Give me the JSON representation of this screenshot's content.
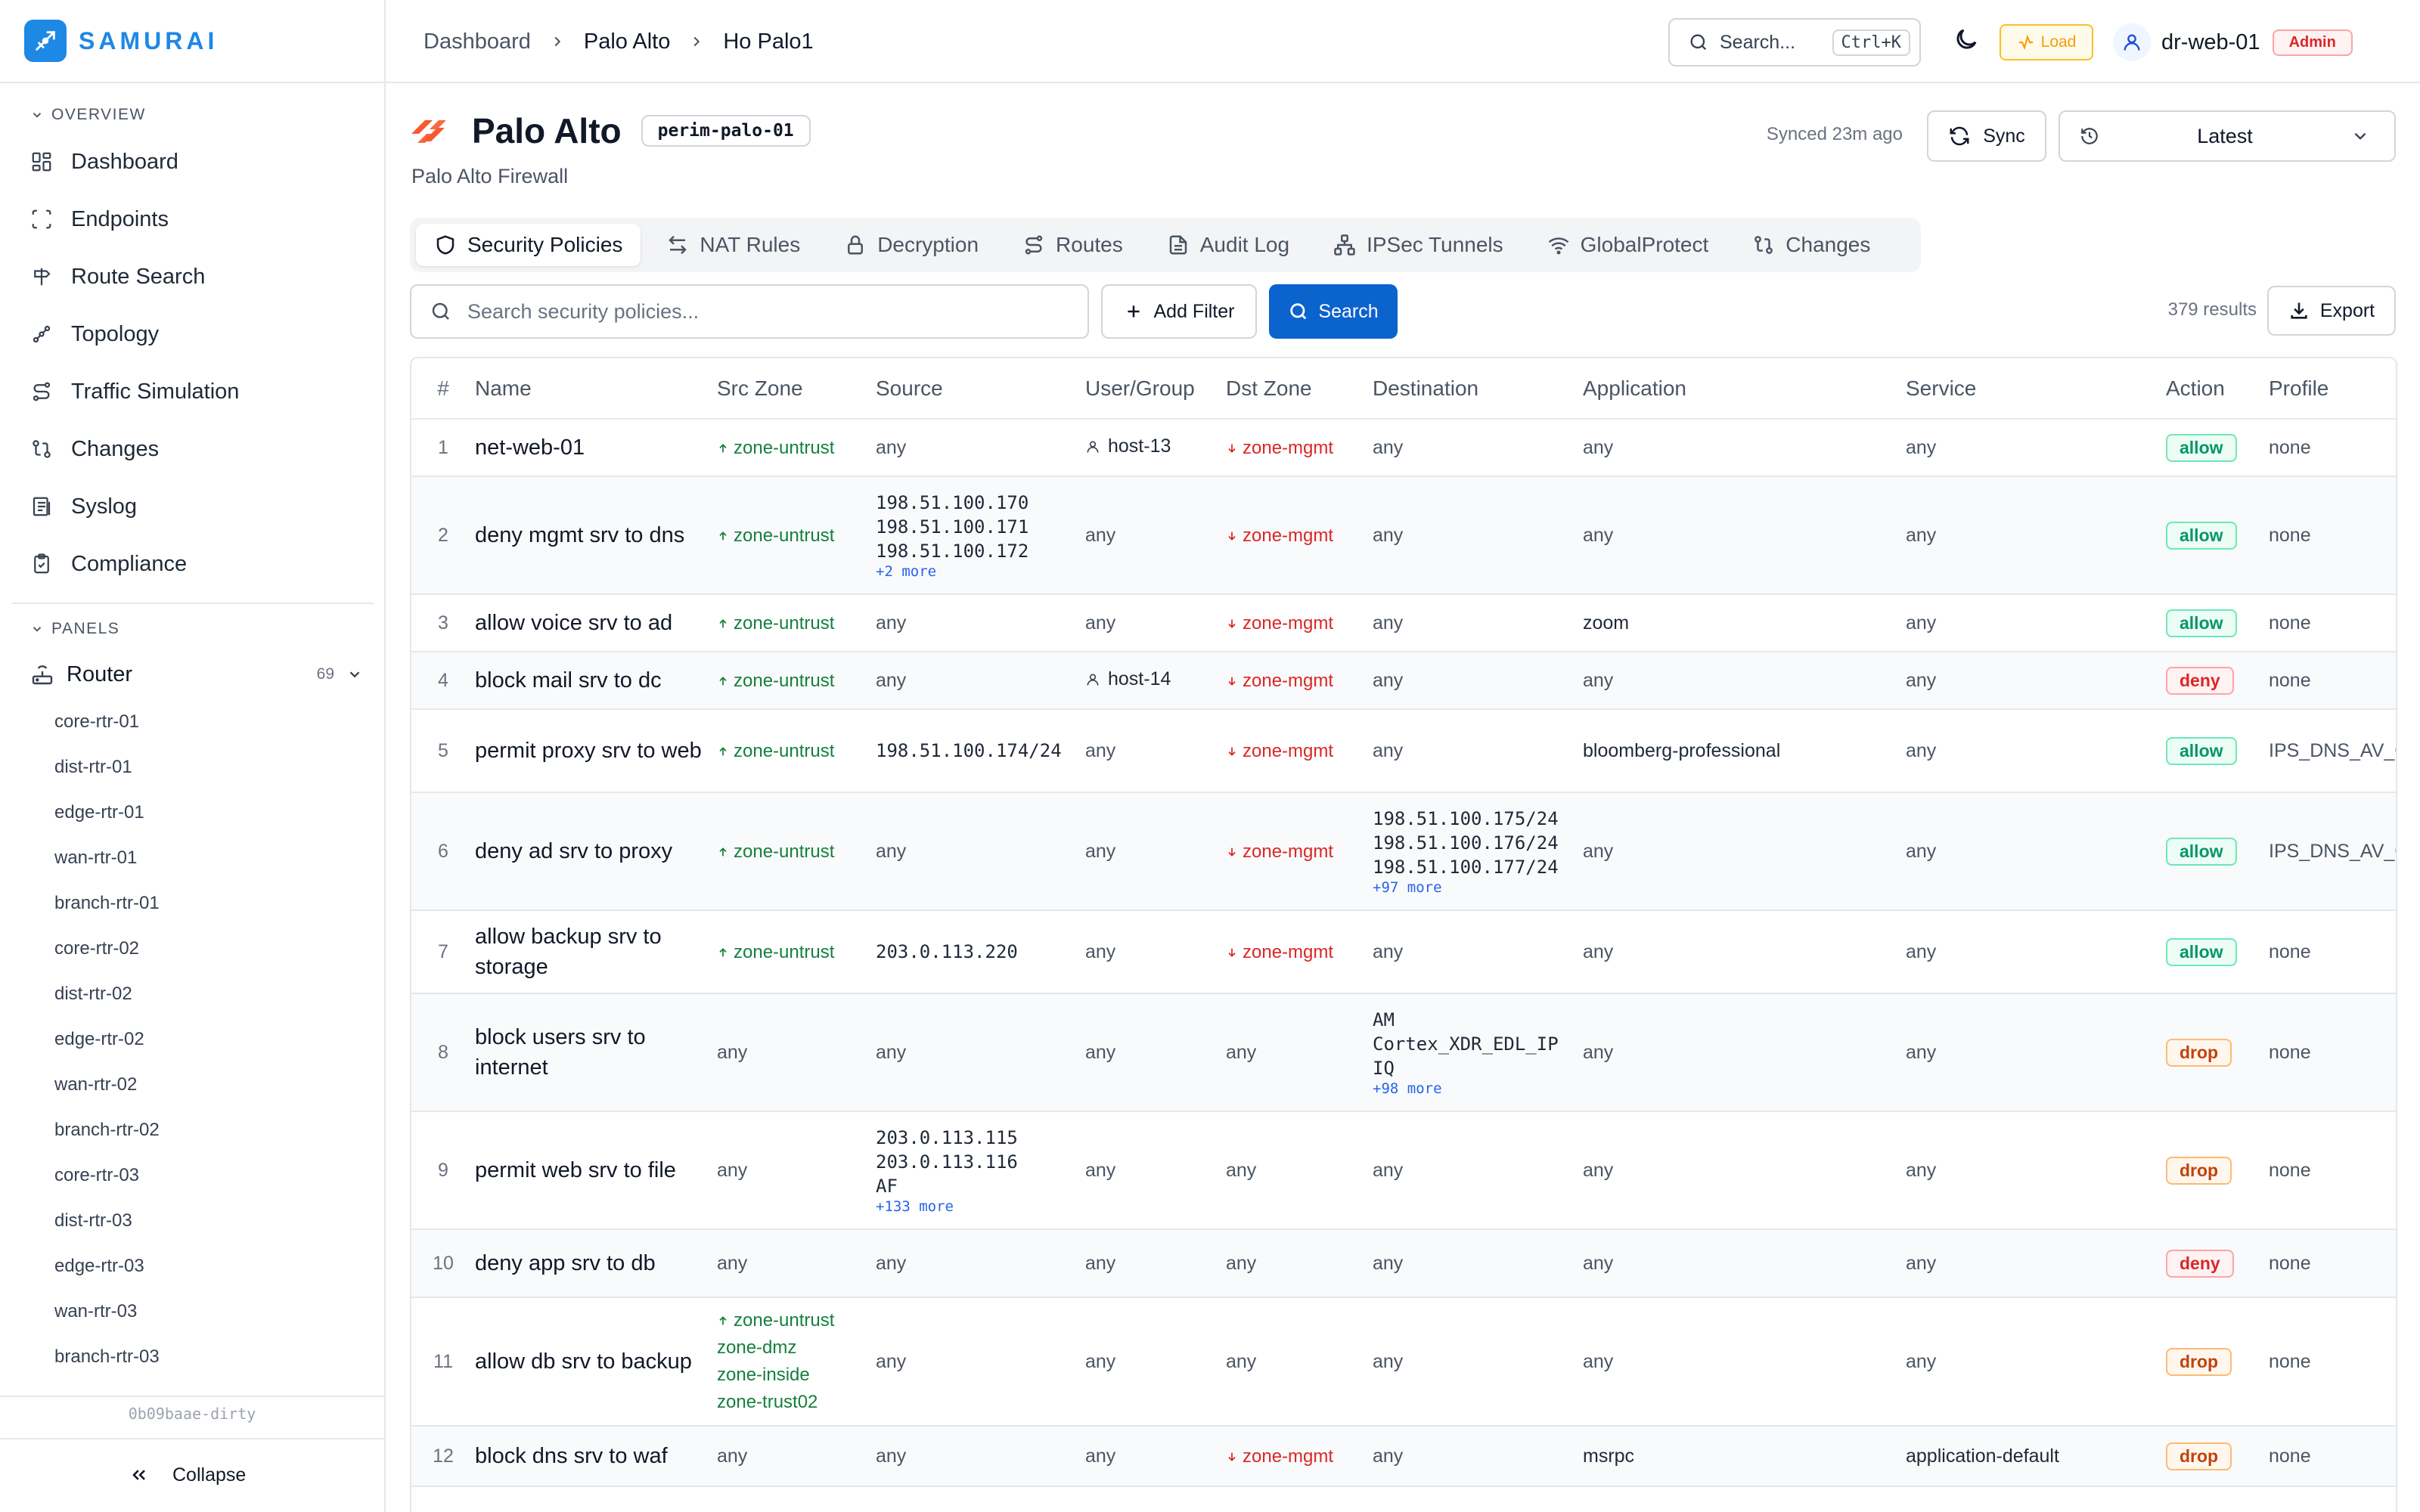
{
  "brand": {
    "name": "SAMURAI"
  },
  "sidebar": {
    "overview_label": "OVERVIEW",
    "nav": [
      {
        "label": "Dashboard",
        "icon": "grid-icon"
      },
      {
        "label": "Endpoints",
        "icon": "scan-icon"
      },
      {
        "label": "Route Search",
        "icon": "signpost-icon"
      },
      {
        "label": "Topology",
        "icon": "topology-icon"
      },
      {
        "label": "Traffic Simulation",
        "icon": "route-icon"
      },
      {
        "label": "Changes",
        "icon": "git-compare-icon"
      },
      {
        "label": "Syslog",
        "icon": "logs-icon"
      },
      {
        "label": "Compliance",
        "icon": "clipboard-check-icon"
      }
    ],
    "panels_label": "PANELS",
    "router": {
      "label": "Router",
      "count": "69"
    },
    "routers": [
      "core-rtr-01",
      "dist-rtr-01",
      "edge-rtr-01",
      "wan-rtr-01",
      "branch-rtr-01",
      "core-rtr-02",
      "dist-rtr-02",
      "edge-rtr-02",
      "wan-rtr-02",
      "branch-rtr-02",
      "core-rtr-03",
      "dist-rtr-03",
      "edge-rtr-03",
      "wan-rtr-03",
      "branch-rtr-03"
    ],
    "version": "0b09baae-dirty",
    "collapse_label": "Collapse"
  },
  "topbar": {
    "breadcrumb": [
      "Dashboard",
      "Palo Alto",
      "Ho Palo1"
    ],
    "search_placeholder": "Search...",
    "search_shortcut": "Ctrl+K",
    "load_label": "Load",
    "user": "dr-web-01",
    "role": "Admin"
  },
  "page": {
    "title": "Palo Alto",
    "hostname": "perim-palo-01",
    "subtitle": "Palo Alto Firewall",
    "synced": "Synced 23m ago",
    "sync_label": "Sync",
    "version_value": "Latest"
  },
  "tabs": [
    {
      "label": "Security Policies",
      "icon": "shield-icon"
    },
    {
      "label": "NAT Rules",
      "icon": "arrows-left-right-icon"
    },
    {
      "label": "Decryption",
      "icon": "lock-icon"
    },
    {
      "label": "Routes",
      "icon": "route-icon"
    },
    {
      "label": "Audit Log",
      "icon": "file-text-icon"
    },
    {
      "label": "IPSec Tunnels",
      "icon": "network-icon"
    },
    {
      "label": "GlobalProtect",
      "icon": "wifi-icon"
    },
    {
      "label": "Changes",
      "icon": "git-compare-icon"
    }
  ],
  "toolbar": {
    "search_placeholder": "Search security policies...",
    "add_filter": "Add Filter",
    "search": "Search",
    "results": "379 results",
    "export": "Export"
  },
  "table": {
    "columns": [
      "#",
      "Name",
      "Src Zone",
      "Source",
      "User/Group",
      "Dst Zone",
      "Destination",
      "Application",
      "Service",
      "Action",
      "Profile"
    ],
    "rows": [
      {
        "num": "1",
        "name": "net-web-01",
        "src_zone": [
          "zone-untrust"
        ],
        "source": [
          "any"
        ],
        "source_more": "",
        "user": "host-13",
        "dst_zone": "zone-mgmt",
        "destination": [
          "any"
        ],
        "dest_more": "",
        "application": "any",
        "service": "any",
        "action": "allow",
        "profile": "none"
      },
      {
        "num": "2",
        "name": "deny mgmt srv to dns",
        "src_zone": [
          "zone-untrust"
        ],
        "source": [
          "198.51.100.170",
          "198.51.100.171",
          "198.51.100.172"
        ],
        "source_more": "+2 more",
        "user": "any",
        "dst_zone": "zone-mgmt",
        "destination": [
          "any"
        ],
        "dest_more": "",
        "application": "any",
        "service": "any",
        "action": "allow",
        "profile": "none"
      },
      {
        "num": "3",
        "name": "allow voice srv to ad",
        "src_zone": [
          "zone-untrust"
        ],
        "source": [
          "any"
        ],
        "source_more": "",
        "user": "any",
        "dst_zone": "zone-mgmt",
        "destination": [
          "any"
        ],
        "dest_more": "",
        "application": "zoom",
        "service": "any",
        "action": "allow",
        "profile": "none"
      },
      {
        "num": "4",
        "name": "block mail srv to dc",
        "src_zone": [
          "zone-untrust"
        ],
        "source": [
          "any"
        ],
        "source_more": "",
        "user": "host-14",
        "dst_zone": "zone-mgmt",
        "destination": [
          "any"
        ],
        "dest_more": "",
        "application": "any",
        "service": "any",
        "action": "deny",
        "profile": "none"
      },
      {
        "num": "5",
        "name": "permit proxy srv to web",
        "src_zone": [
          "zone-untrust"
        ],
        "source": [
          "198.51.100.174/24"
        ],
        "source_more": "",
        "user": "any",
        "dst_zone": "zone-mgmt",
        "destination": [
          "any"
        ],
        "dest_more": "",
        "application": "bloomberg-professional",
        "service": "any",
        "action": "allow",
        "profile": "IPS_DNS_AV_C"
      },
      {
        "num": "6",
        "name": "deny ad srv to proxy",
        "src_zone": [
          "zone-untrust"
        ],
        "source": [
          "any"
        ],
        "source_more": "",
        "user": "any",
        "dst_zone": "zone-mgmt",
        "destination": [
          "198.51.100.175/24",
          "198.51.100.176/24",
          "198.51.100.177/24"
        ],
        "dest_more": "+97 more",
        "application": "any",
        "service": "any",
        "action": "allow",
        "profile": "IPS_DNS_AV_C"
      },
      {
        "num": "7",
        "name": "allow backup srv to storage",
        "src_zone": [
          "zone-untrust"
        ],
        "source": [
          "203.0.113.220"
        ],
        "source_more": "",
        "user": "any",
        "dst_zone": "zone-mgmt",
        "destination": [
          "any"
        ],
        "dest_more": "",
        "application": "any",
        "service": "any",
        "action": "allow",
        "profile": "none"
      },
      {
        "num": "8",
        "name": "block users srv to internet",
        "src_zone": [],
        "source": [
          "any"
        ],
        "source_more": "",
        "user": "any",
        "dst_zone": "",
        "destination": [
          "AM",
          "Cortex_XDR_EDL_IP",
          "IQ"
        ],
        "dest_more": "+98 more",
        "application": "any",
        "service": "any",
        "action": "drop",
        "profile": "none"
      },
      {
        "num": "9",
        "name": "permit web srv to file",
        "src_zone": [],
        "source": [
          "203.0.113.115",
          "203.0.113.116",
          "AF"
        ],
        "source_more": "+133 more",
        "user": "any",
        "dst_zone": "",
        "destination": [
          "any"
        ],
        "dest_more": "",
        "application": "any",
        "service": "any",
        "action": "drop",
        "profile": "none"
      },
      {
        "num": "10",
        "name": "deny app srv to db",
        "src_zone": [],
        "source": [
          "any"
        ],
        "source_more": "",
        "user": "any",
        "dst_zone": "",
        "destination": [
          "any"
        ],
        "dest_more": "",
        "application": "any",
        "service": "any",
        "action": "deny",
        "profile": "none"
      },
      {
        "num": "11",
        "name": "allow db srv to backup",
        "src_zone": [
          "zone-untrust",
          "zone-dmz",
          "zone-inside",
          "zone-trust02"
        ],
        "source": [
          "any"
        ],
        "source_more": "",
        "user": "any",
        "dst_zone": "",
        "destination": [
          "any"
        ],
        "dest_more": "",
        "application": "any",
        "service": "any",
        "action": "drop",
        "profile": "none"
      },
      {
        "num": "12",
        "name": "block dns srv to waf",
        "src_zone": [],
        "source": [
          "any"
        ],
        "source_more": "",
        "user": "any",
        "dst_zone": "zone-mgmt",
        "destination": [
          "any"
        ],
        "dest_more": "",
        "application": "msrpc",
        "service": "application-default",
        "action": "drop",
        "profile": "none"
      }
    ]
  },
  "colors": {
    "brand": "#1e88e5",
    "primary": "#0b63ce",
    "allow": "#059669",
    "deny": "#dc2626",
    "drop": "#c2410c",
    "palo_alto": "#fa582d"
  }
}
